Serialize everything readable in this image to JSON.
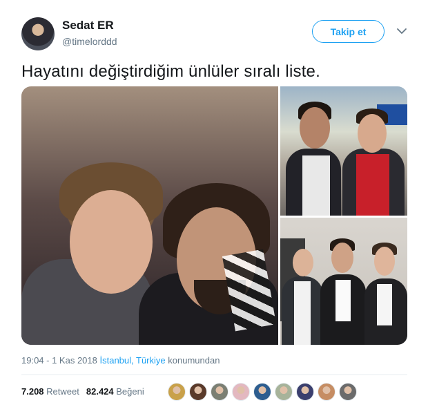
{
  "author": {
    "display_name": "Sedat ER",
    "username": "@timelorddd"
  },
  "actions": {
    "follow_label": "Takip et"
  },
  "tweet": {
    "text": "Hayatını değiştirdiğim ünlüler sıralı liste."
  },
  "meta": {
    "time": "19:04 - 1 Kas 2018",
    "location": "İstanbul, Türkiye",
    "location_suffix": "konumundan"
  },
  "stats": {
    "retweet_count": "7.208",
    "retweet_label": "Retweet",
    "like_count": "82.424",
    "like_label": "Beğeni"
  },
  "likers": [
    {
      "color": "#c9a14a"
    },
    {
      "color": "#5a3a2a"
    },
    {
      "color": "#7b7f73"
    },
    {
      "color": "#e3b8c0"
    },
    {
      "color": "#2d5d8f"
    },
    {
      "color": "#a7b39a"
    },
    {
      "color": "#3b3f6e"
    },
    {
      "color": "#c68d63"
    },
    {
      "color": "#6b6b6b"
    }
  ],
  "colors": {
    "accent": "#1da1f2",
    "secondary_text": "#657786",
    "primary_text": "#14171a"
  }
}
